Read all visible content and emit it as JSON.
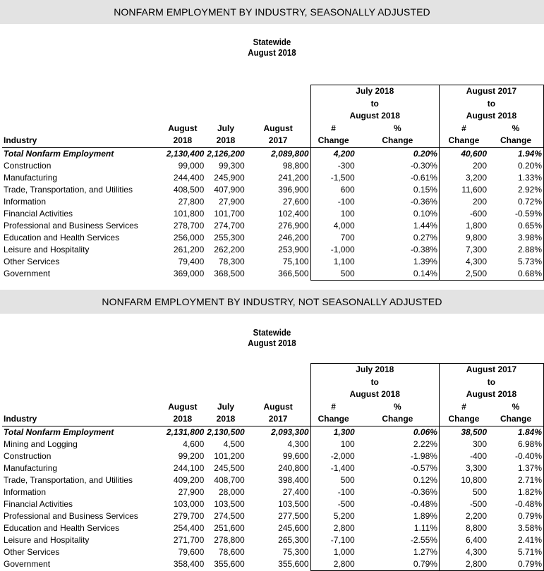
{
  "sa": {
    "banner": "NONFARM EMPLOYMENT BY INDUSTRY, SEASONALLY ADJUSTED",
    "region": "Statewide",
    "month": "August 2018",
    "period1": [
      "July 2018",
      "to",
      "August 2018"
    ],
    "period2": [
      "August 2017",
      "to",
      "August 2018"
    ],
    "headers": {
      "industry": "Industry",
      "aug2018": [
        "August",
        "2018"
      ],
      "jul2018": [
        "July",
        "2018"
      ],
      "aug2017": [
        "August",
        "2017"
      ],
      "num": [
        "#",
        "Change"
      ],
      "pct": [
        "%",
        "Change"
      ]
    },
    "rows": [
      [
        "Total Nonfarm Employment",
        "2,130,400",
        "2,126,200",
        "2,089,800",
        "4,200",
        "0.20%",
        "40,600",
        "1.94%"
      ],
      [
        "Construction",
        "99,000",
        "99,300",
        "98,800",
        "-300",
        "-0.30%",
        "200",
        "0.20%"
      ],
      [
        "Manufacturing",
        "244,400",
        "245,900",
        "241,200",
        "-1,500",
        "-0.61%",
        "3,200",
        "1.33%"
      ],
      [
        "Trade, Transportation, and Utilities",
        "408,500",
        "407,900",
        "396,900",
        "600",
        "0.15%",
        "11,600",
        "2.92%"
      ],
      [
        "Information",
        "27,800",
        "27,900",
        "27,600",
        "-100",
        "-0.36%",
        "200",
        "0.72%"
      ],
      [
        "Financial Activities",
        "101,800",
        "101,700",
        "102,400",
        "100",
        "0.10%",
        "-600",
        "-0.59%"
      ],
      [
        "Professional and Business Services",
        "278,700",
        "274,700",
        "276,900",
        "4,000",
        "1.44%",
        "1,800",
        "0.65%"
      ],
      [
        "Education and Health Services",
        "256,000",
        "255,300",
        "246,200",
        "700",
        "0.27%",
        "9,800",
        "3.98%"
      ],
      [
        "Leisure and Hospitality",
        "261,200",
        "262,200",
        "253,900",
        "-1,000",
        "-0.38%",
        "7,300",
        "2.88%"
      ],
      [
        "Other Services",
        "79,400",
        "78,300",
        "75,100",
        "1,100",
        "1.39%",
        "4,300",
        "5.73%"
      ],
      [
        "Government",
        "369,000",
        "368,500",
        "366,500",
        "500",
        "0.14%",
        "2,500",
        "0.68%"
      ]
    ]
  },
  "nsa": {
    "banner": "NONFARM EMPLOYMENT BY INDUSTRY, NOT SEASONALLY ADJUSTED",
    "region": "Statewide",
    "month": "August 2018",
    "period1": [
      "July 2018",
      "to",
      "August 2018"
    ],
    "period2": [
      "August 2017",
      "to",
      "August 2018"
    ],
    "headers": {
      "industry": "Industry",
      "aug2018": [
        "August",
        "2018"
      ],
      "jul2018": [
        "July",
        "2018"
      ],
      "aug2017": [
        "August",
        "2017"
      ],
      "num": [
        "#",
        "Change"
      ],
      "pct": [
        "%",
        "Change"
      ]
    },
    "rows": [
      [
        "Total Nonfarm Employment",
        "2,131,800",
        "2,130,500",
        "2,093,300",
        "1,300",
        "0.06%",
        "38,500",
        "1.84%"
      ],
      [
        "Mining and Logging",
        "4,600",
        "4,500",
        "4,300",
        "100",
        "2.22%",
        "300",
        "6.98%"
      ],
      [
        "Construction",
        "99,200",
        "101,200",
        "99,600",
        "-2,000",
        "-1.98%",
        "-400",
        "-0.40%"
      ],
      [
        "Manufacturing",
        "244,100",
        "245,500",
        "240,800",
        "-1,400",
        "-0.57%",
        "3,300",
        "1.37%"
      ],
      [
        "Trade, Transportation, and Utilities",
        "409,200",
        "408,700",
        "398,400",
        "500",
        "0.12%",
        "10,800",
        "2.71%"
      ],
      [
        "Information",
        "27,900",
        "28,000",
        "27,400",
        "-100",
        "-0.36%",
        "500",
        "1.82%"
      ],
      [
        "Financial Activities",
        "103,000",
        "103,500",
        "103,500",
        "-500",
        "-0.48%",
        "-500",
        "-0.48%"
      ],
      [
        "Professional and Business Services",
        "279,700",
        "274,500",
        "277,500",
        "5,200",
        "1.89%",
        "2,200",
        "0.79%"
      ],
      [
        "Education and Health Services",
        "254,400",
        "251,600",
        "245,600",
        "2,800",
        "1.11%",
        "8,800",
        "3.58%"
      ],
      [
        "Leisure and Hospitality",
        "271,700",
        "278,800",
        "265,300",
        "-7,100",
        "-2.55%",
        "6,400",
        "2.41%"
      ],
      [
        "Other Services",
        "79,600",
        "78,600",
        "75,300",
        "1,000",
        "1.27%",
        "4,300",
        "5.71%"
      ],
      [
        "Government",
        "358,400",
        "355,600",
        "355,600",
        "2,800",
        "0.79%",
        "2,800",
        "0.79%"
      ]
    ]
  }
}
